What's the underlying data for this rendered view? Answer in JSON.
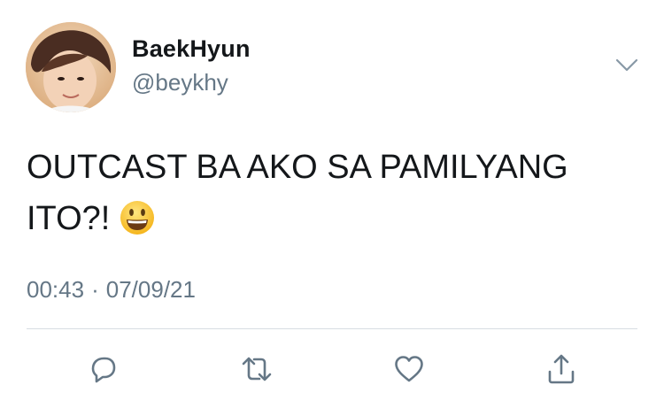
{
  "author": {
    "display_name": "BaekHyun",
    "handle": "@beykhy"
  },
  "tweet": {
    "text": "OUTCAST BA AKO SA PAMILYANG ITO?!",
    "emoji": "grinning-face-emoji"
  },
  "meta": {
    "time": "00:43",
    "separator": "·",
    "date": "07/09/21"
  },
  "actions": {
    "icons": [
      "reply-icon",
      "retweet-icon",
      "like-icon",
      "share-icon"
    ]
  },
  "colors": {
    "text": "#14171a",
    "secondary": "#657786",
    "divider": "#d7dde2",
    "icon": "#657786"
  }
}
